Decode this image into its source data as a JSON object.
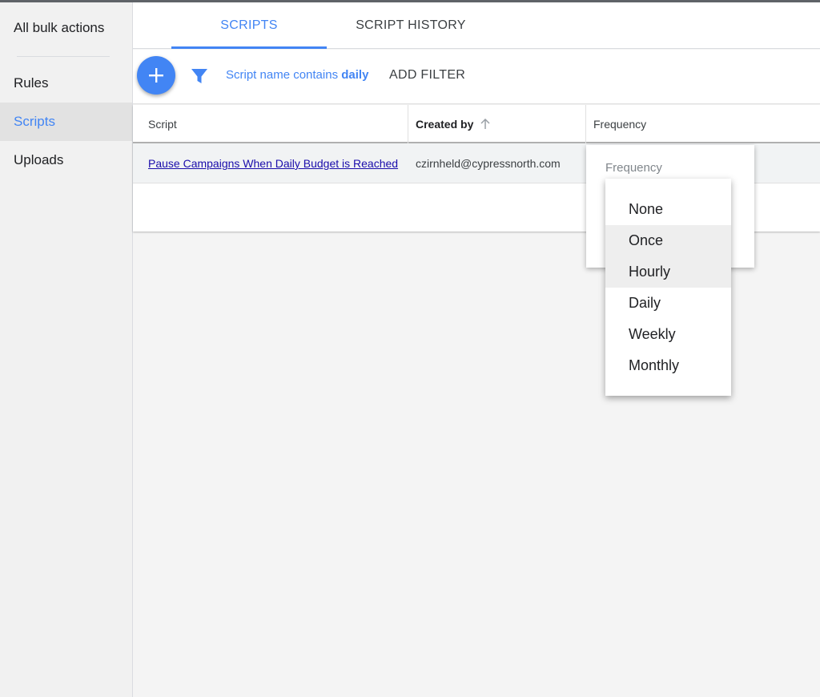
{
  "sidebar": {
    "items": [
      {
        "label": "All bulk actions"
      },
      {
        "label": "Rules"
      },
      {
        "label": "Scripts",
        "active": true
      },
      {
        "label": "Uploads"
      }
    ]
  },
  "tabs": [
    {
      "label": "SCRIPTS",
      "active": true
    },
    {
      "label": "SCRIPT HISTORY"
    }
  ],
  "toolbar": {
    "add_icon": "plus-icon",
    "filter_icon": "filter-funnel-icon",
    "filter_prefix": "Script name contains",
    "filter_value": "daily",
    "add_filter_label": "ADD FILTER"
  },
  "table": {
    "headers": {
      "script": "Script",
      "created_by": "Created by",
      "frequency": "Frequency"
    },
    "sort_icon": "arrow-up-icon",
    "rows": [
      {
        "script": "Pause Campaigns When Daily Budget is Reached",
        "created_by": "czirnheld@cypressnorth.com"
      }
    ]
  },
  "frequency_editor": {
    "label": "Frequency",
    "options": [
      "None",
      "Once",
      "Hourly",
      "Daily",
      "Weekly",
      "Monthly"
    ]
  },
  "colors": {
    "accent": "#4285f4",
    "link": "#1a0dab"
  }
}
